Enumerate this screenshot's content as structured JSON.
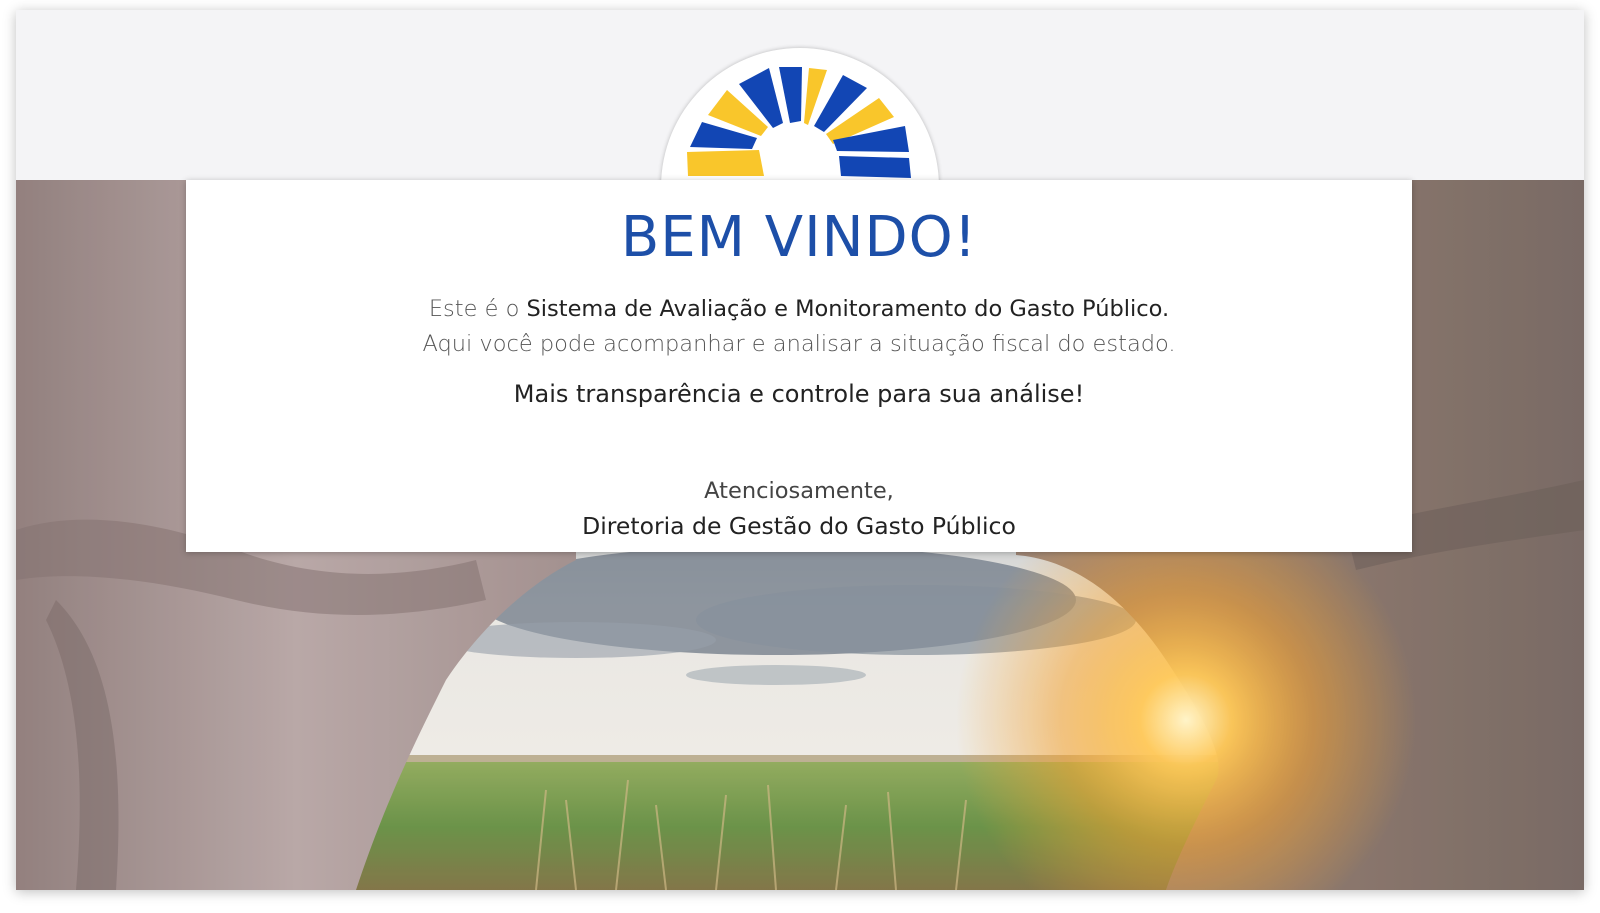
{
  "welcome": {
    "title": "BEM VINDO!",
    "line1_prefix": "Este é o ",
    "line1_system": "Sistema de Avaliação e Monitoramento do Gasto Público.",
    "line2": "Aqui você pode acompanhar e analisar a situação fiscal do estado.",
    "highlight": "Mais transparência e controle para sua análise!",
    "closing": "Atenciosamente,",
    "signature": "Diretoria de Gestão do Gasto Público"
  },
  "logo": {
    "icon": "sunburst-logo-icon",
    "colors": [
      "#1246b4",
      "#f9c62b"
    ]
  },
  "colors": {
    "title": "#1d4fa8",
    "frame_background": "#f4f4f6"
  },
  "background": {
    "icon": "landscape-image"
  }
}
